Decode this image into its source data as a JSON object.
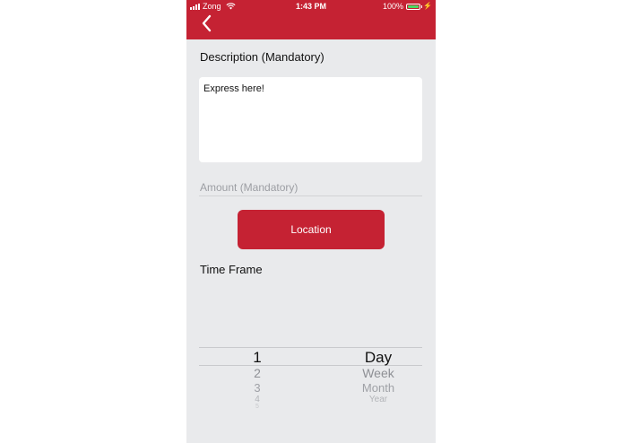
{
  "status_bar": {
    "carrier": "Zong",
    "time": "1:43 PM",
    "battery": "100%",
    "battery_level": 1.0
  },
  "header": {
    "back_icon": "chevron-left-icon"
  },
  "form": {
    "description_label": "Description (Mandatory)",
    "description_value": "Express here!",
    "amount_placeholder": "Amount (Mandatory)",
    "location_button": "Location",
    "time_frame_label": "Time Frame"
  },
  "picker": {
    "numbers": [
      "1",
      "2",
      "3",
      "4",
      "5"
    ],
    "units": [
      "Day",
      "Week",
      "Month",
      "Year"
    ],
    "selected_number": "1",
    "selected_unit": "Day"
  },
  "colors": {
    "accent": "#c52233",
    "background": "#e9eaec"
  }
}
